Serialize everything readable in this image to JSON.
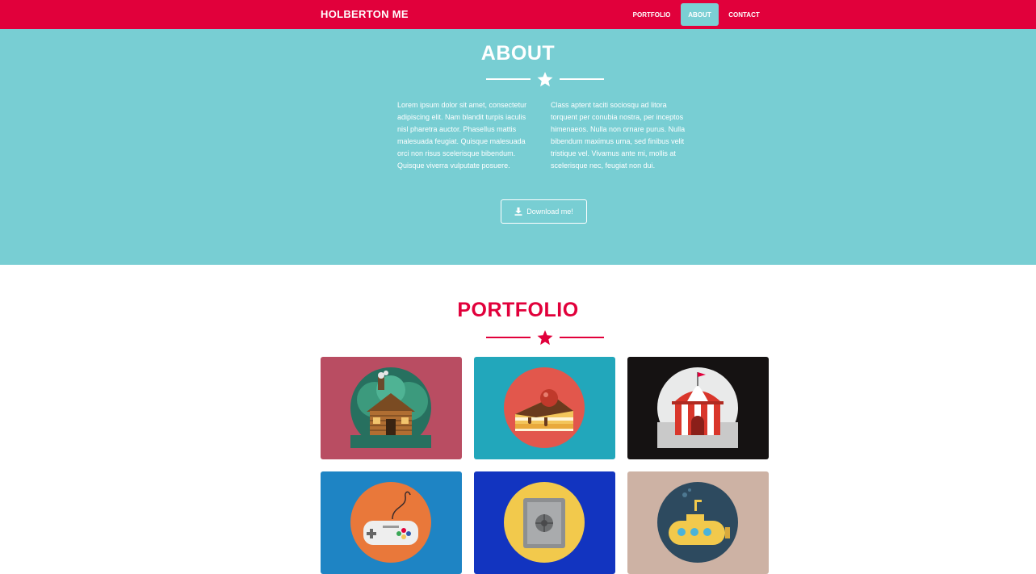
{
  "navbar": {
    "brand": "HOLBERTON ME",
    "items": [
      {
        "label": "PORTFOLIO",
        "active": false
      },
      {
        "label": "ABOUT",
        "active": true
      },
      {
        "label": "CONTACT",
        "active": false
      }
    ]
  },
  "about": {
    "title": "ABOUT",
    "divider_icon": "star-icon",
    "col1": "Lorem ipsum dolor sit amet, consectetur adipiscing elit. Nam blandit turpis iaculis nisl pharetra auctor. Phasellus mattis malesuada feugiat. Quisque malesuada orci non risus scelerisque bibendum. Quisque viverra vulputate posuere.",
    "col2": "Class aptent taciti sociosqu ad litora torquent per conubia nostra, per inceptos himenaeos. Nulla non ornare purus. Nulla bibendum maximus urna, sed finibus velit tristique vel. Vivamus ante mi, mollis at scelerisque nec, feugiat non dui.",
    "download_label": "Download me!",
    "download_icon": "download-icon"
  },
  "portfolio": {
    "title": "PORTFOLIO",
    "divider_icon": "star-icon",
    "items": [
      {
        "icon": "cabin-icon",
        "bg": "#b94d62"
      },
      {
        "icon": "cake-icon",
        "bg": "#22a7bb"
      },
      {
        "icon": "circus-tent-icon",
        "bg": "#151212"
      },
      {
        "icon": "game-controller-icon",
        "bg": "#1e84c4"
      },
      {
        "icon": "safe-icon",
        "bg": "#1234c0"
      },
      {
        "icon": "submarine-icon",
        "bg": "#cdb2a4"
      }
    ]
  },
  "colors": {
    "brand_red": "#e1003b",
    "about_bg": "#78ced3",
    "active_nav": "#7bcfd4"
  }
}
